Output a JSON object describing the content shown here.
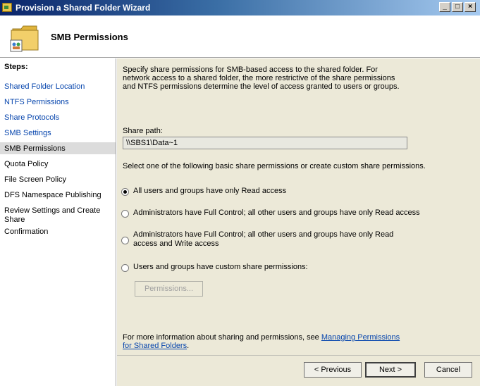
{
  "window": {
    "title": "Provision a Shared Folder Wizard",
    "controls": [
      "_",
      "□",
      "×"
    ]
  },
  "header": {
    "title": "SMB Permissions",
    "icon": "folder-share-icon"
  },
  "steps": {
    "title": "Steps:",
    "items": [
      {
        "label": "Shared Folder Location",
        "state": "link"
      },
      {
        "label": "NTFS Permissions",
        "state": "link"
      },
      {
        "label": "Share Protocols",
        "state": "link"
      },
      {
        "label": "SMB Settings",
        "state": "link"
      },
      {
        "label": "SMB Permissions",
        "state": "current"
      },
      {
        "label": "Quota Policy",
        "state": "normal"
      },
      {
        "label": "File Screen Policy",
        "state": "normal"
      },
      {
        "label": "DFS Namespace Publishing",
        "state": "normal"
      },
      {
        "label": "Review Settings and Create Share",
        "state": "normal"
      },
      {
        "label": "Confirmation",
        "state": "normal"
      }
    ]
  },
  "main": {
    "description": "Specify share permissions for SMB-based access to the shared folder. For network access to a shared folder, the more restrictive of the share permissions and NTFS permissions determine the level of access granted to users or groups.",
    "share_path_label": "Share path:",
    "share_path_value": "\\\\SBS1\\Data~1",
    "select_prompt": "Select one of the following basic share permissions or create custom share permissions.",
    "options": [
      {
        "label": "All users and groups have only Read access",
        "checked": true
      },
      {
        "label": "Administrators have Full Control; all other users and groups have only Read access",
        "checked": false
      },
      {
        "label": "Administrators have Full Control; all other users and groups have only Read access and Write access",
        "checked": false
      },
      {
        "label": "Users and groups have custom share permissions:",
        "checked": false
      }
    ],
    "permissions_button": "Permissions...",
    "info_text": "For more information about sharing and permissions, see ",
    "info_link": "Managing Permissions for Shared Folders",
    "info_end": "."
  },
  "footer": {
    "previous": "< Previous",
    "next": "Next >",
    "cancel": "Cancel"
  },
  "colors": {
    "link": "#0645ad",
    "content_bg": "#ece9d8",
    "title_bar": "#0a246a"
  }
}
